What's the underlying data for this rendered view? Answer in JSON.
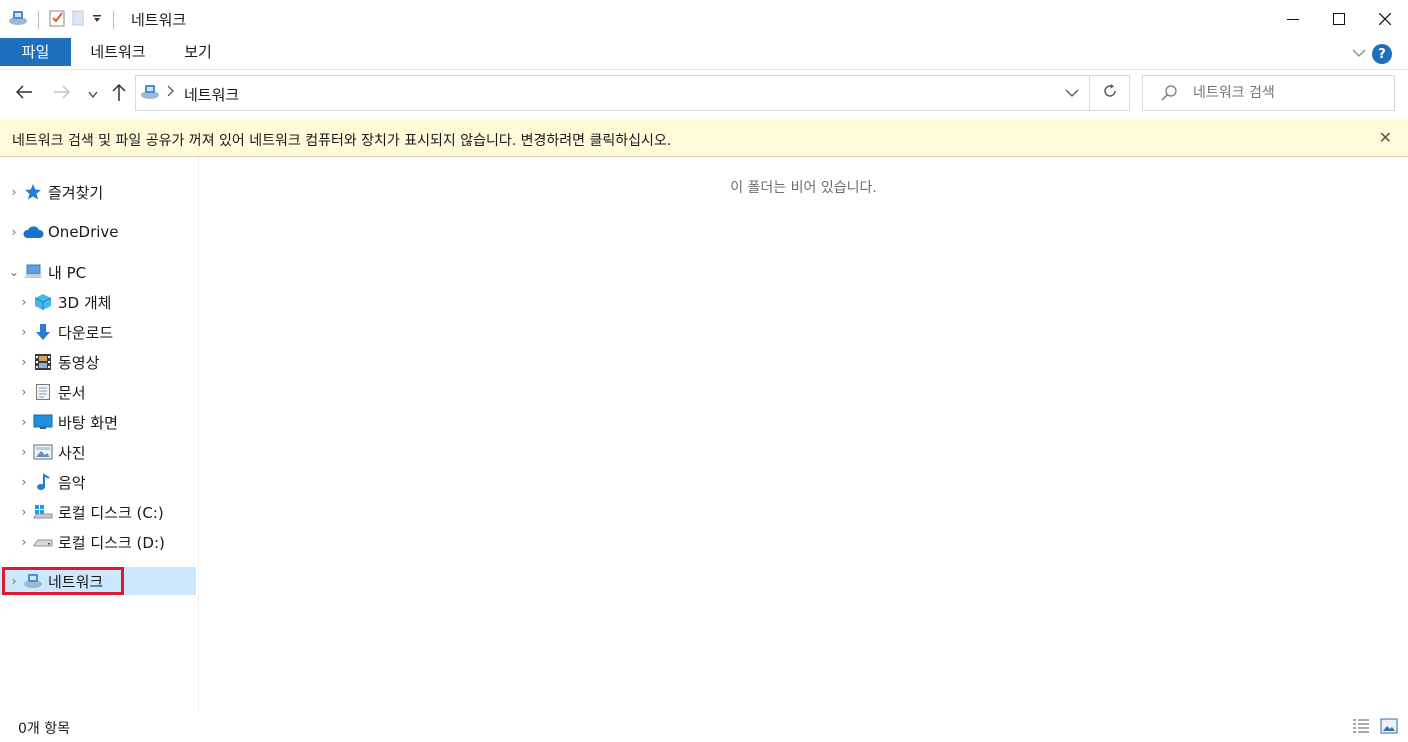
{
  "window": {
    "title": "네트워크",
    "controls": [
      "minimize-icon",
      "maximize-icon",
      "close-icon"
    ]
  },
  "quick_access": {
    "icons": [
      "network-icon",
      "properties-icon",
      "new-folder-icon",
      "customize-dropdown-icon"
    ]
  },
  "ribbon": {
    "tabs": [
      {
        "label": "파일",
        "active": true
      },
      {
        "label": "네트워크",
        "active": false
      },
      {
        "label": "보기",
        "active": false
      }
    ],
    "accent": "#1f6fbf"
  },
  "address_bar": {
    "crumb": "네트워크",
    "search_placeholder": "네트워크 검색"
  },
  "infobar": {
    "message": "네트워크 검색 및 파일 공유가 꺼져 있어 네트워크 컴퓨터와 장치가 표시되지 않습니다. 변경하려면 클릭하십시오.",
    "background": "#fffbd9"
  },
  "nav": {
    "favorites": "즐겨찾기",
    "onedrive": "OneDrive",
    "this_pc": "내 PC",
    "pc_items": [
      "3D 개체",
      "다운로드",
      "동영상",
      "문서",
      "바탕 화면",
      "사진",
      "음악",
      "로컬 디스크 (C:)",
      "로컬 디스크 (D:)"
    ],
    "network": "네트워크"
  },
  "content": {
    "empty_text": "이 폴더는 비어 있습니다."
  },
  "status": {
    "count": "0개 항목"
  }
}
